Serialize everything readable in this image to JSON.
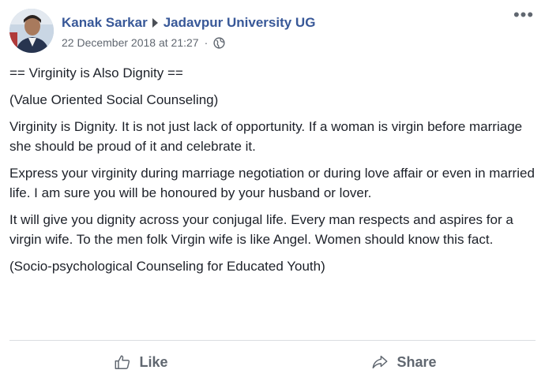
{
  "post": {
    "author": "Kanak Sarkar",
    "group": "Jadavpur University UG",
    "timestamp": "22 December 2018 at 21:27",
    "separator": "·",
    "privacy_icon": "globe-icon",
    "more_icon": "more-options-icon",
    "paragraphs": [
      "== Virginity is Also Dignity ==",
      "(Value Oriented Social Counseling)",
      "Virginity is Dignity. It is not just lack of opportunity. If a woman is virgin before marriage she should be proud of it and celebrate it.",
      "Express your virginity during marriage negotiation or during love affair or even in married life. I am sure you will be honoured by your husband or lover.",
      "It will give you dignity across your conjugal life. Every man respects and aspires for a virgin wife. To the men folk Virgin wife is like Angel. Women should know this fact.",
      "(Socio-psychological Counseling for Educated Youth)"
    ]
  },
  "actions": {
    "like_label": "Like",
    "share_label": "Share"
  },
  "colors": {
    "author_link": "#385898",
    "meta_text": "#606770",
    "body_text": "#1d2129",
    "divider": "#dadde1"
  }
}
